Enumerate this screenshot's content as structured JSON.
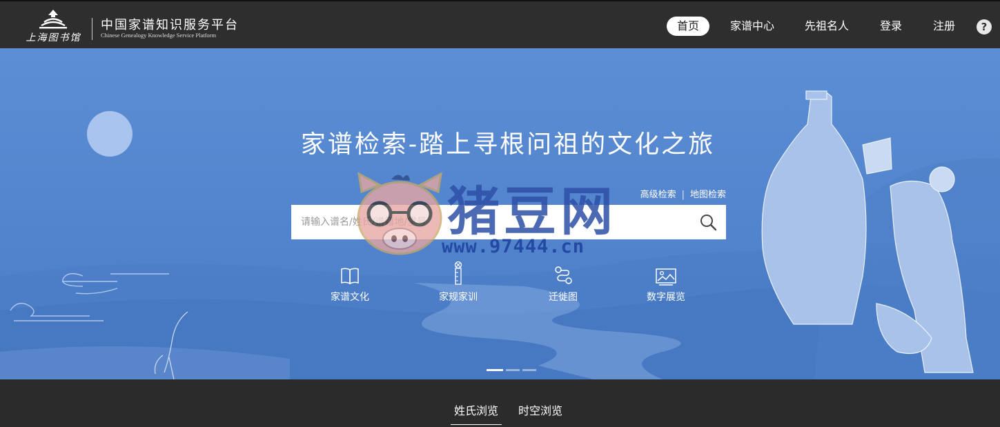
{
  "header": {
    "logo_script": "上海图书馆",
    "title": "中国家谱知识服务平台",
    "subtitle": "Chinese Genealogy Knowledge Service Platform",
    "nav": [
      {
        "label": "首页",
        "active": true
      },
      {
        "label": "家谱中心"
      },
      {
        "label": "先祖名人"
      },
      {
        "label": "登录"
      },
      {
        "label": "注册"
      }
    ],
    "help_icon": "?"
  },
  "banner": {
    "title": "家谱检索-踏上寻根问祖的文化之旅",
    "links": {
      "advanced": "高级检索",
      "separator": "|",
      "map": "地图检索"
    },
    "search": {
      "placeholder": "请输入谱名/姓氏/谱籍地/堂号"
    },
    "quick_links": [
      {
        "label": "家谱文化",
        "icon": "book-icon"
      },
      {
        "label": "家规家训",
        "icon": "ruler-icon"
      },
      {
        "label": "迁徙图",
        "icon": "route-icon"
      },
      {
        "label": "数字展览",
        "icon": "picture-icon"
      }
    ],
    "carousel": {
      "count": 3,
      "active": 0
    }
  },
  "watermark": {
    "brand": "猪豆网",
    "url": "www.97444.cn"
  },
  "tabs": [
    {
      "label": "姓氏浏览",
      "active": true
    },
    {
      "label": "时空浏览"
    }
  ],
  "colors": {
    "header_bg": "#2e2e2e",
    "banner_blue": "#5486cf",
    "accent": "#ffffff"
  }
}
